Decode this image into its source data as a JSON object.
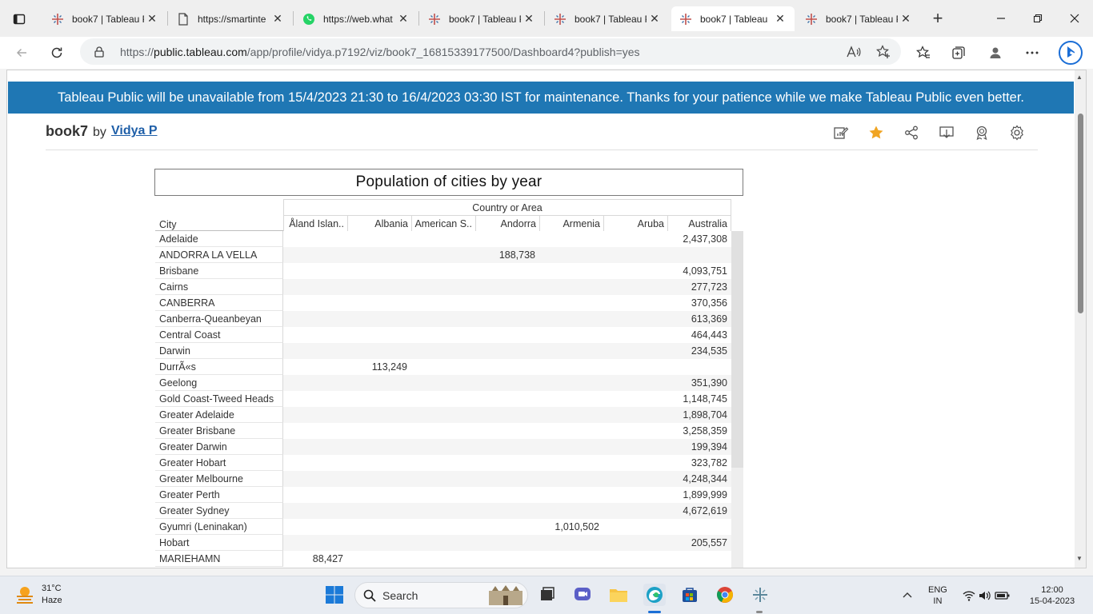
{
  "browser": {
    "tabs": [
      {
        "title": "book7 | Tableau P",
        "icon": "tableau-icon"
      },
      {
        "title": "https://smartinte",
        "icon": "page-icon"
      },
      {
        "title": "https://web.what",
        "icon": "whatsapp-icon"
      },
      {
        "title": "book7 | Tableau P",
        "icon": "tableau-icon"
      },
      {
        "title": "book7 | Tableau P",
        "icon": "tableau-icon"
      },
      {
        "title": "book7 | Tableau",
        "icon": "tableau-icon"
      },
      {
        "title": "book7 | Tableau P",
        "icon": "tableau-icon"
      }
    ],
    "url_prefix": "https://",
    "url_domain": "public.tableau.com",
    "url_path": "/app/profile/vidya.p7192/viz/book7_16815339177500/Dashboard4?publish=yes"
  },
  "page": {
    "banner": "Tableau Public will be unavailable from 15/4/2023 21:30 to 16/4/2023 03:30 IST for maintenance. Thanks for your patience while we make Tableau Public even better.",
    "workbook": "book7",
    "by": "by",
    "author": "Vidya P"
  },
  "viz": {
    "title": "Population of cities by year",
    "column_group_header": "Country or Area",
    "row_header": "City",
    "columns": [
      "Åland Islan..",
      "Albania",
      "American S..",
      "Andorra",
      "Armenia",
      "Aruba",
      "Australia"
    ],
    "rows": [
      {
        "city": "Adelaide",
        "values": [
          "",
          "",
          "",
          "",
          "",
          "",
          "2,437,308"
        ]
      },
      {
        "city": "ANDORRA LA VELLA",
        "values": [
          "",
          "",
          "",
          "188,738",
          "",
          "",
          ""
        ]
      },
      {
        "city": "Brisbane",
        "values": [
          "",
          "",
          "",
          "",
          "",
          "",
          "4,093,751"
        ]
      },
      {
        "city": "Cairns",
        "values": [
          "",
          "",
          "",
          "",
          "",
          "",
          "277,723"
        ]
      },
      {
        "city": "CANBERRA",
        "values": [
          "",
          "",
          "",
          "",
          "",
          "",
          "370,356"
        ]
      },
      {
        "city": "Canberra-Queanbeyan",
        "values": [
          "",
          "",
          "",
          "",
          "",
          "",
          "613,369"
        ]
      },
      {
        "city": "Central Coast",
        "values": [
          "",
          "",
          "",
          "",
          "",
          "",
          "464,443"
        ]
      },
      {
        "city": "Darwin",
        "values": [
          "",
          "",
          "",
          "",
          "",
          "",
          "234,535"
        ]
      },
      {
        "city": "DurrÃ«s",
        "values": [
          "",
          "113,249",
          "",
          "",
          "",
          "",
          ""
        ]
      },
      {
        "city": "Geelong",
        "values": [
          "",
          "",
          "",
          "",
          "",
          "",
          "351,390"
        ]
      },
      {
        "city": "Gold Coast-Tweed Heads",
        "values": [
          "",
          "",
          "",
          "",
          "",
          "",
          "1,148,745"
        ]
      },
      {
        "city": "Greater Adelaide",
        "values": [
          "",
          "",
          "",
          "",
          "",
          "",
          "1,898,704"
        ]
      },
      {
        "city": "Greater Brisbane",
        "values": [
          "",
          "",
          "",
          "",
          "",
          "",
          "3,258,359"
        ]
      },
      {
        "city": "Greater Darwin",
        "values": [
          "",
          "",
          "",
          "",
          "",
          "",
          "199,394"
        ]
      },
      {
        "city": "Greater Hobart",
        "values": [
          "",
          "",
          "",
          "",
          "",
          "",
          "323,782"
        ]
      },
      {
        "city": "Greater Melbourne",
        "values": [
          "",
          "",
          "",
          "",
          "",
          "",
          "4,248,344"
        ]
      },
      {
        "city": "Greater Perth",
        "values": [
          "",
          "",
          "",
          "",
          "",
          "",
          "1,899,999"
        ]
      },
      {
        "city": "Greater Sydney",
        "values": [
          "",
          "",
          "",
          "",
          "",
          "",
          "4,672,619"
        ]
      },
      {
        "city": "Gyumri (Leninakan)",
        "values": [
          "",
          "",
          "",
          "",
          "1,010,502",
          "",
          ""
        ]
      },
      {
        "city": "Hobart",
        "values": [
          "",
          "",
          "",
          "",
          "",
          "",
          "205,557"
        ]
      },
      {
        "city": "MARIEHAMN",
        "values": [
          "88,427",
          "",
          "",
          "",
          "",
          "",
          ""
        ]
      }
    ]
  },
  "taskbar": {
    "temperature": "31°C",
    "condition": "Haze",
    "search_label": "Search",
    "language": "ENG",
    "region": "IN",
    "time": "12:00",
    "date": "15-04-2023"
  },
  "colors": {
    "banner": "#1f77b4",
    "author_link": "#1f5fa8",
    "favorite_star": "#f0a422"
  }
}
